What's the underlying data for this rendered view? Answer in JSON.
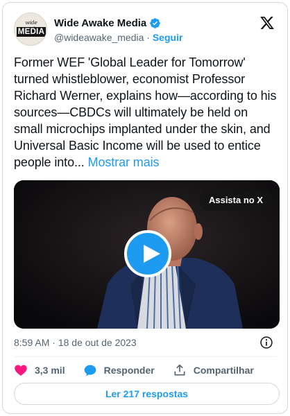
{
  "author": {
    "name": "Wide Awake Media",
    "handle": "@wideawake_media",
    "separator": "·",
    "follow_label": "Seguir",
    "avatar_top_text": "wide awake",
    "avatar_bar_text": "MEDIA",
    "verified": true
  },
  "icons": {
    "brand": "x-logo-icon",
    "verified": "verified-badge-icon",
    "play": "play-icon",
    "info": "info-icon",
    "like": "heart-icon",
    "reply": "reply-bubble-icon",
    "share": "share-icon"
  },
  "tweet": {
    "text": "Former WEF 'Global Leader for Tomorrow' turned whistleblower, economist Professor Richard Werner, explains how—according to his sources—CBDCs will ultimately be held on small microchips implanted under the skin, and Universal Basic Income will be used to entice people into...",
    "show_more": "Mostrar mais"
  },
  "media": {
    "watch_label": "Assista no X"
  },
  "meta": {
    "time": "8:59 AM",
    "separator": "·",
    "date": "18 de out de 2023"
  },
  "actions": {
    "like_count": "3,3 mil",
    "reply_label": "Responder",
    "share_label": "Compartilhar"
  },
  "replies_button": "Ler 217 respostas",
  "colors": {
    "accent": "#1d9bf0",
    "like": "#f91880",
    "text": "#0f1419",
    "muted": "#536471",
    "border": "#cfd9de"
  }
}
